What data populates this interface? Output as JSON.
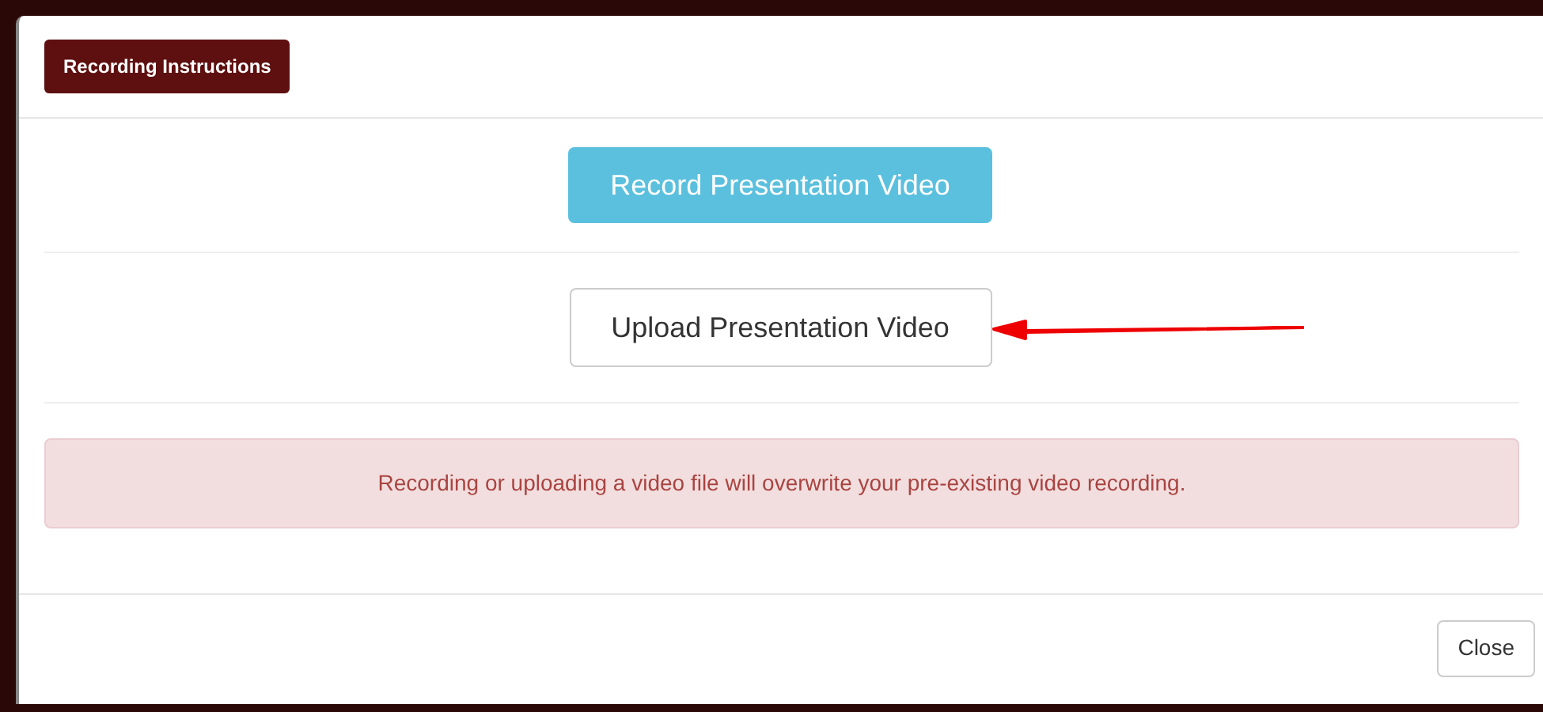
{
  "header": {
    "instructions_button": "Recording Instructions"
  },
  "record_button": "Record Presentation Video",
  "upload_button": "Upload Presentation Video",
  "alert": "Recording or uploading a video file will overwrite your pre-existing video recording.",
  "footer": {
    "close_button": "Close"
  }
}
